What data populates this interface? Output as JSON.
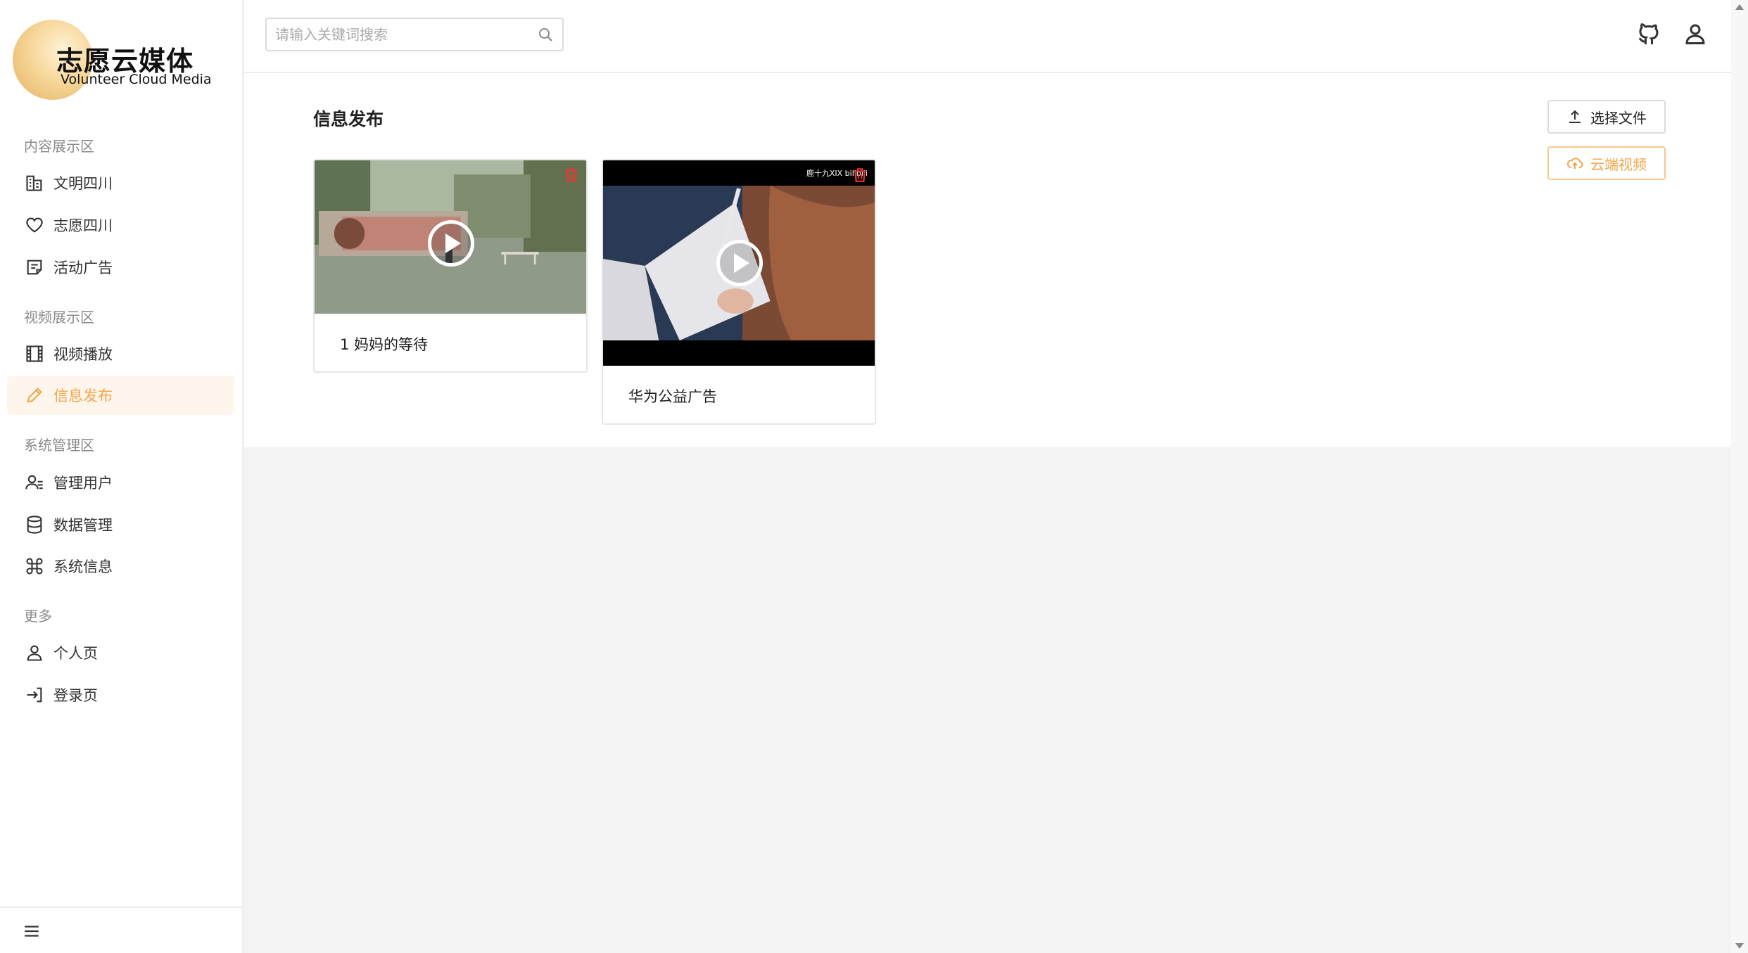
{
  "brand": {
    "title": "志愿云媒体",
    "subtitle": "Volunteer Cloud Media"
  },
  "sidebar": {
    "sections": [
      {
        "label": "内容展示区",
        "items": [
          {
            "label": "文明四川",
            "icon": "building-icon"
          },
          {
            "label": "志愿四川",
            "icon": "heart-icon"
          },
          {
            "label": "活动广告",
            "icon": "note-icon"
          }
        ]
      },
      {
        "label": "视频展示区",
        "items": [
          {
            "label": "视频播放",
            "icon": "film-icon"
          },
          {
            "label": "信息发布",
            "icon": "pencil-icon",
            "active": true
          }
        ]
      },
      {
        "label": "系统管理区",
        "items": [
          {
            "label": "管理用户",
            "icon": "user-list-icon"
          },
          {
            "label": "数据管理",
            "icon": "database-icon"
          },
          {
            "label": "系统信息",
            "icon": "command-icon"
          }
        ]
      },
      {
        "label": "更多",
        "items": [
          {
            "label": "个人页",
            "icon": "user-icon"
          },
          {
            "label": "登录页",
            "icon": "login-icon"
          }
        ]
      }
    ]
  },
  "header": {
    "search_placeholder": "请输入关键词搜索"
  },
  "main": {
    "title": "信息发布",
    "upload_label": "选择文件",
    "cloud_label": "云端视频",
    "videos": [
      {
        "title": "1 妈妈的等待"
      },
      {
        "title": "华为公益广告",
        "watermark": "鹿十九XIX  bilibili"
      }
    ]
  },
  "colors": {
    "accent": "#f3a64a",
    "active_bg": "#fef6ec",
    "delete": "#e53935"
  }
}
